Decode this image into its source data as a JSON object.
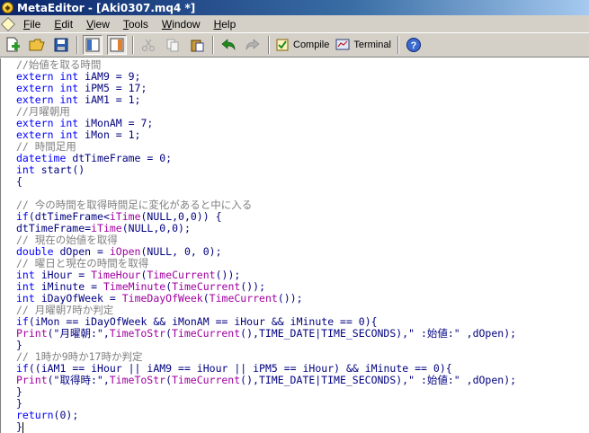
{
  "window": {
    "title": "MetaEditor - [Aki0307.mq4 *]"
  },
  "menu": {
    "items": [
      {
        "label": "File",
        "key": "F"
      },
      {
        "label": "Edit",
        "key": "E"
      },
      {
        "label": "View",
        "key": "V"
      },
      {
        "label": "Tools",
        "key": "T"
      },
      {
        "label": "Window",
        "key": "W"
      },
      {
        "label": "Help",
        "key": "H"
      }
    ]
  },
  "toolbar": {
    "compile_label": "Compile",
    "terminal_label": "Terminal"
  },
  "colors": {
    "comment": "#808080",
    "keyword": "#0000ff",
    "function": "#a000a0",
    "text": "#000080"
  },
  "editor": {
    "lines": [
      [
        {
          "t": "//始値を取る時間",
          "c": "comment"
        }
      ],
      [
        {
          "t": "extern int",
          "c": "keyword"
        },
        {
          "t": " iAM9 = 9;",
          "c": "plain"
        }
      ],
      [
        {
          "t": "extern int",
          "c": "keyword"
        },
        {
          "t": " iPM5 = 17;",
          "c": "plain"
        }
      ],
      [
        {
          "t": "extern int",
          "c": "keyword"
        },
        {
          "t": " iAM1 = 1;",
          "c": "plain"
        }
      ],
      [
        {
          "t": "//月曜朝用",
          "c": "comment"
        }
      ],
      [
        {
          "t": "extern int",
          "c": "keyword"
        },
        {
          "t": " iMonAM = 7;",
          "c": "plain"
        }
      ],
      [
        {
          "t": "extern int",
          "c": "keyword"
        },
        {
          "t": " iMon = 1;",
          "c": "plain"
        }
      ],
      [
        {
          "t": "// 時間足用",
          "c": "comment"
        }
      ],
      [
        {
          "t": "datetime",
          "c": "keyword"
        },
        {
          "t": " dtTimeFrame = 0;",
          "c": "plain"
        }
      ],
      [
        {
          "t": "int",
          "c": "keyword"
        },
        {
          "t": " start()",
          "c": "plain"
        }
      ],
      [
        {
          "t": "{",
          "c": "plain"
        }
      ],
      [
        {
          "t": "",
          "c": "plain"
        }
      ],
      [
        {
          "t": "// 今の時間を取得時間足に変化があると中に入る",
          "c": "comment"
        }
      ],
      [
        {
          "t": "if",
          "c": "keyword"
        },
        {
          "t": "(dtTimeFrame<",
          "c": "plain"
        },
        {
          "t": "iTime",
          "c": "func"
        },
        {
          "t": "(NULL,0,0)) {",
          "c": "plain"
        }
      ],
      [
        {
          "t": "dtTimeFrame=",
          "c": "plain"
        },
        {
          "t": "iTime",
          "c": "func"
        },
        {
          "t": "(NULL,0,0);",
          "c": "plain"
        }
      ],
      [
        {
          "t": "// 現在の始値を取得",
          "c": "comment"
        }
      ],
      [
        {
          "t": "double",
          "c": "keyword"
        },
        {
          "t": " dOpen = ",
          "c": "plain"
        },
        {
          "t": "iOpen",
          "c": "func"
        },
        {
          "t": "(NULL, 0, 0);",
          "c": "plain"
        }
      ],
      [
        {
          "t": "// 曜日と現在の時間を取得",
          "c": "comment"
        }
      ],
      [
        {
          "t": "int",
          "c": "keyword"
        },
        {
          "t": " iHour = ",
          "c": "plain"
        },
        {
          "t": "TimeHour",
          "c": "func"
        },
        {
          "t": "(",
          "c": "plain"
        },
        {
          "t": "TimeCurrent",
          "c": "func"
        },
        {
          "t": "());",
          "c": "plain"
        }
      ],
      [
        {
          "t": "int",
          "c": "keyword"
        },
        {
          "t": " iMinute = ",
          "c": "plain"
        },
        {
          "t": "TimeMinute",
          "c": "func"
        },
        {
          "t": "(",
          "c": "plain"
        },
        {
          "t": "TimeCurrent",
          "c": "func"
        },
        {
          "t": "());",
          "c": "plain"
        }
      ],
      [
        {
          "t": "int",
          "c": "keyword"
        },
        {
          "t": " iDayOfWeek = ",
          "c": "plain"
        },
        {
          "t": "TimeDayOfWeek",
          "c": "func"
        },
        {
          "t": "(",
          "c": "plain"
        },
        {
          "t": "TimeCurrent",
          "c": "func"
        },
        {
          "t": "());",
          "c": "plain"
        }
      ],
      [
        {
          "t": "// 月曜朝7時か判定",
          "c": "comment"
        }
      ],
      [
        {
          "t": "if",
          "c": "keyword"
        },
        {
          "t": "(iMon == iDayOfWeek && iMonAM == iHour && iMinute == 0){",
          "c": "plain"
        }
      ],
      [
        {
          "t": "Print",
          "c": "func"
        },
        {
          "t": "(\"月曜朝:\",",
          "c": "plain"
        },
        {
          "t": "TimeToStr",
          "c": "func"
        },
        {
          "t": "(",
          "c": "plain"
        },
        {
          "t": "TimeCurrent",
          "c": "func"
        },
        {
          "t": "(),TIME_DATE|TIME_SECONDS),\" :始値:\" ,dOpen);",
          "c": "plain"
        }
      ],
      [
        {
          "t": "}",
          "c": "plain"
        }
      ],
      [
        {
          "t": "// 1時か9時か17時か判定",
          "c": "comment"
        }
      ],
      [
        {
          "t": "if",
          "c": "keyword"
        },
        {
          "t": "((iAM1 == iHour || iAM9 == iHour || iPM5 == iHour) && iMinute == 0){",
          "c": "plain"
        }
      ],
      [
        {
          "t": "Print",
          "c": "func"
        },
        {
          "t": "(\"取得時:\",",
          "c": "plain"
        },
        {
          "t": "TimeToStr",
          "c": "func"
        },
        {
          "t": "(",
          "c": "plain"
        },
        {
          "t": "TimeCurrent",
          "c": "func"
        },
        {
          "t": "(),TIME_DATE|TIME_SECONDS),\" :始値:\" ,dOpen);",
          "c": "plain"
        }
      ],
      [
        {
          "t": "}",
          "c": "plain"
        }
      ],
      [
        {
          "t": "}",
          "c": "plain"
        }
      ],
      [
        {
          "t": "return",
          "c": "keyword"
        },
        {
          "t": "(0);",
          "c": "plain"
        }
      ],
      [
        {
          "t": "}",
          "c": "plain"
        }
      ]
    ]
  }
}
